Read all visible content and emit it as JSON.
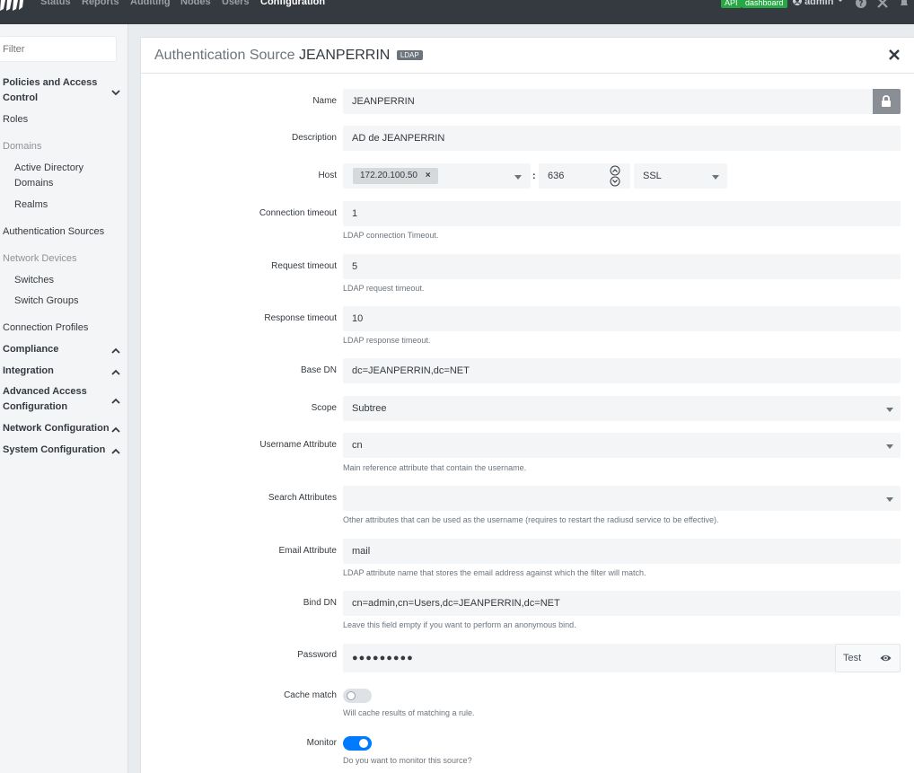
{
  "nav": {
    "items": [
      "Status",
      "Reports",
      "Auditing",
      "Nodes",
      "Users",
      "Configuration"
    ],
    "active": "Configuration",
    "badges": [
      "API",
      "dashboard"
    ],
    "user": "admin",
    "icons": [
      "help-icon",
      "tools-icon",
      "bell-icon"
    ]
  },
  "sidebar": {
    "filter_placeholder": "Filter",
    "policies_label": "Policies and Access Control",
    "roles": "Roles",
    "domains_header": "Domains",
    "active_directory": "Active Directory Domains",
    "realms": "Realms",
    "auth_sources": "Authentication Sources",
    "network_devices_header": "Network Devices",
    "switches": "Switches",
    "switch_groups": "Switch Groups",
    "connection_profiles": "Connection Profiles",
    "compliance": "Compliance",
    "integration": "Integration",
    "advanced_access": "Advanced Access Configuration",
    "network_configuration": "Network Configuration",
    "system_configuration": "System Configuration"
  },
  "card": {
    "title_prefix": "Authentication Source",
    "title_name": "JEANPERRIN",
    "type_badge": "LDAP"
  },
  "form": {
    "name": {
      "label": "Name",
      "value": "JEANPERRIN"
    },
    "description": {
      "label": "Description",
      "value": "AD de JEANPERRIN"
    },
    "host": {
      "label": "Host",
      "value": "172.20.100.50",
      "port": "636",
      "encryption": "SSL"
    },
    "connection_timeout": {
      "label": "Connection timeout",
      "value": "1",
      "help": "LDAP connection Timeout."
    },
    "request_timeout": {
      "label": "Request timeout",
      "value": "5",
      "help": "LDAP request timeout."
    },
    "response_timeout": {
      "label": "Response timeout",
      "value": "10",
      "help": "LDAP response timeout."
    },
    "base_dn": {
      "label": "Base DN",
      "value": "dc=JEANPERRIN,dc=NET"
    },
    "scope": {
      "label": "Scope",
      "value": "Subtree"
    },
    "username_attribute": {
      "label": "Username Attribute",
      "value": "cn",
      "help": "Main reference attribute that contain the username."
    },
    "search_attributes": {
      "label": "Search Attributes",
      "value": "",
      "help": "Other attributes that can be used as the username (requires to restart the radiusd service to be effective)."
    },
    "email_attribute": {
      "label": "Email Attribute",
      "value": "mail",
      "help": "LDAP attribute name that stores the email address against which the filter will match."
    },
    "bind_dn": {
      "label": "Bind DN",
      "value": "cn=admin,cn=Users,dc=JEANPERRIN,dc=NET",
      "help": "Leave this field empty if you want to perform an anonymous bind."
    },
    "password": {
      "label": "Password",
      "value": "●●●●●●●●●",
      "test_label": "Test"
    },
    "cache_match": {
      "label": "Cache match",
      "enabled": false,
      "help": "Will cache results of matching a rule."
    },
    "monitor": {
      "label": "Monitor",
      "enabled": true,
      "help": "Do you want to monitor this source?"
    }
  },
  "colors": {
    "topbar": "#343a40",
    "accent": "#007bff",
    "badge_green": "#28a745"
  }
}
